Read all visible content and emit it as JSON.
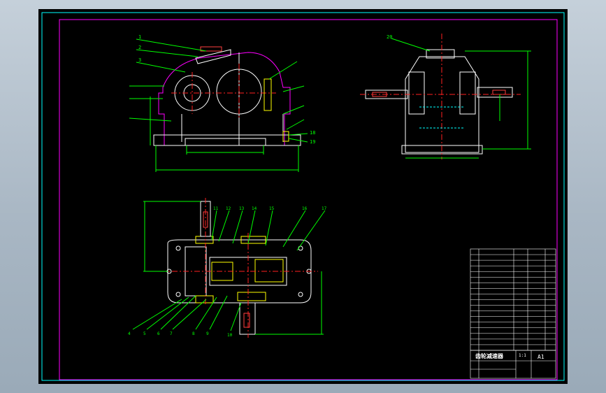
{
  "drawing": {
    "title": "齿轮减速器",
    "sheet_size": "A1"
  },
  "colors": {
    "background": "#000000",
    "frame": "#ff00ff",
    "outline": "#ffffff",
    "centerline": "#ff2020",
    "dimension": "#00ff00",
    "leader": "#00ff00",
    "hidden": "#00ffff",
    "gear": "#ffff00"
  },
  "labels": {
    "front": [
      "1",
      "2",
      "3"
    ],
    "side": [
      "20"
    ],
    "top_upper": [
      "11",
      "12",
      "13",
      "14",
      "15",
      "16",
      "17"
    ],
    "top_lower": [
      "4",
      "5",
      "6",
      "7",
      "8",
      "9",
      "10"
    ],
    "front_right": [
      "18",
      "19"
    ]
  },
  "bom_rows": 18,
  "title_block": {
    "name": "齿轮减速器",
    "scale": "1:1",
    "sheet": "A1"
  }
}
